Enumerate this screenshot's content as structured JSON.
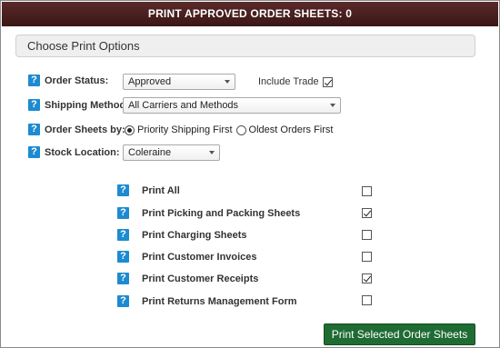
{
  "title": "PRINT APPROVED ORDER SHEETS: 0",
  "options_header": "Choose Print Options",
  "help_glyph": "?",
  "order_status": {
    "label": "Order Status:",
    "value": "Approved"
  },
  "include_trade": {
    "label": "Include Trade",
    "checked": true
  },
  "shipping_method": {
    "label": "Shipping Method:",
    "value": "All Carriers and Methods"
  },
  "order_sheets_by": {
    "label": "Order Sheets by:",
    "options": [
      {
        "label": "Priority Shipping First",
        "selected": true
      },
      {
        "label": "Oldest Orders First",
        "selected": false
      }
    ]
  },
  "stock_location": {
    "label": "Stock Location:",
    "value": "Coleraine"
  },
  "print_options": [
    {
      "label": "Print All",
      "checked": false
    },
    {
      "label": "Print Picking and Packing Sheets",
      "checked": true
    },
    {
      "label": "Print Charging Sheets",
      "checked": false
    },
    {
      "label": "Print Customer Invoices",
      "checked": false
    },
    {
      "label": "Print Customer Receipts",
      "checked": true
    },
    {
      "label": "Print Returns Management Form",
      "checked": false
    }
  ],
  "print_button": "Print Selected Order Sheets",
  "colors": {
    "titlebar": "#4a1f1f",
    "help_icon": "#1d8bd0",
    "print_button": "#1f6b34"
  }
}
